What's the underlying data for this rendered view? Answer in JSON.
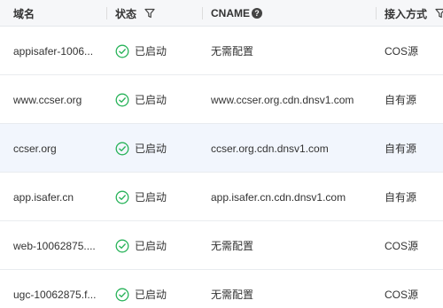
{
  "header": {
    "domain": "域名",
    "status": "状态",
    "cname": "CNAME",
    "access": "接入方式"
  },
  "colors": {
    "status_ok": "#29b35a",
    "row_hover": "#f2f6fd",
    "header_bg": "#f6f7f9"
  },
  "rows": [
    {
      "domain": "appisafer-1006...",
      "status": "已启动",
      "cname": "无需配置",
      "access": "COS源"
    },
    {
      "domain": "www.ccser.org",
      "status": "已启动",
      "cname": "www.ccser.org.cdn.dnsv1.com",
      "access": "自有源"
    },
    {
      "domain": "ccser.org",
      "status": "已启动",
      "cname": "ccser.org.cdn.dnsv1.com",
      "access": "自有源"
    },
    {
      "domain": "app.isafer.cn",
      "status": "已启动",
      "cname": "app.isafer.cn.cdn.dnsv1.com",
      "access": "自有源"
    },
    {
      "domain": "web-10062875....",
      "status": "已启动",
      "cname": "无需配置",
      "access": "COS源"
    },
    {
      "domain": "ugc-10062875.f...",
      "status": "已启动",
      "cname": "无需配置",
      "access": "COS源"
    }
  ]
}
